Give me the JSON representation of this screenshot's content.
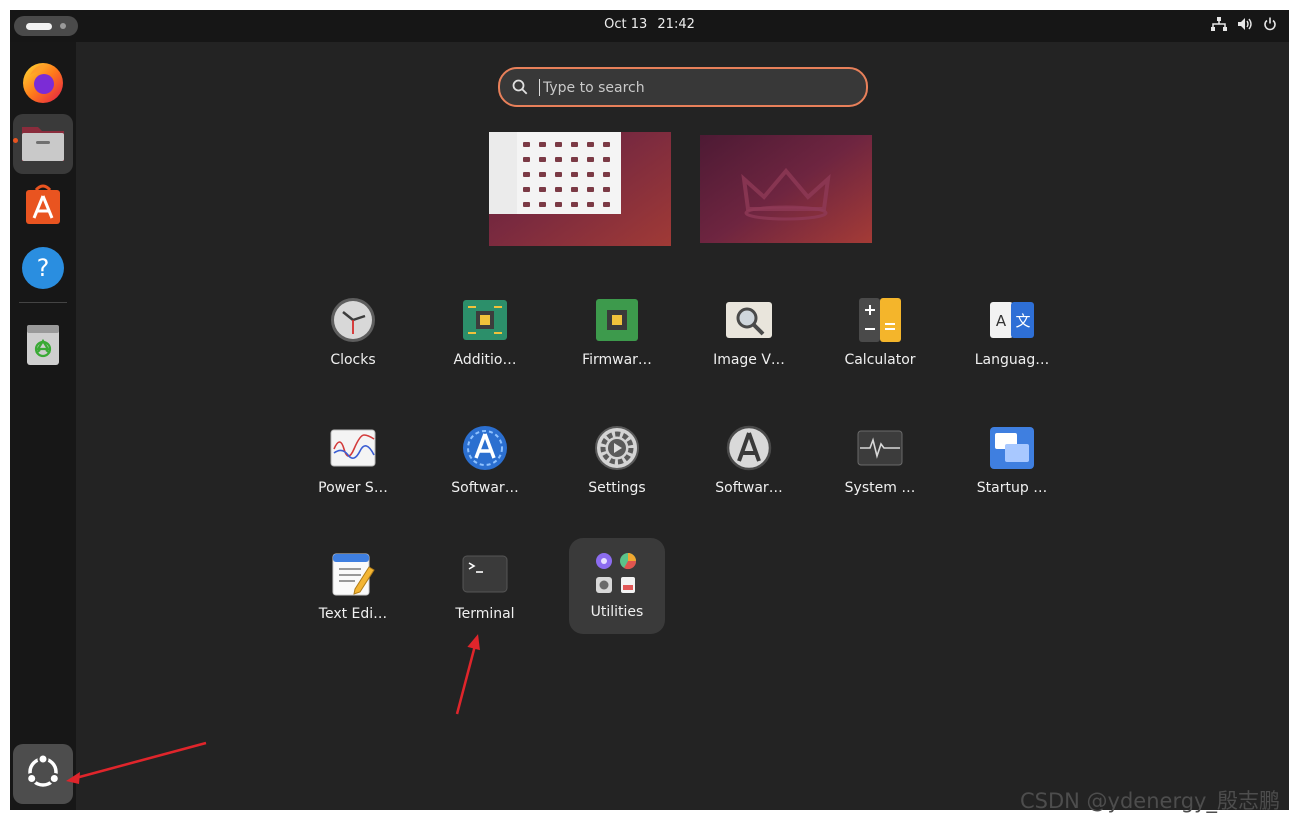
{
  "topbar": {
    "date": "Oct 13",
    "time": "21:42"
  },
  "search": {
    "placeholder": "Type to search"
  },
  "apps": [
    {
      "label": "Clocks",
      "icon": "clock-icon"
    },
    {
      "label": "Additio…",
      "icon": "additional-drivers-icon"
    },
    {
      "label": "Firmwar…",
      "icon": "firmware-icon"
    },
    {
      "label": "Image V…",
      "icon": "image-viewer-icon"
    },
    {
      "label": "Calculator",
      "icon": "calculator-icon"
    },
    {
      "label": "Languag…",
      "icon": "language-support-icon"
    },
    {
      "label": "Power S…",
      "icon": "power-statistics-icon"
    },
    {
      "label": "Softwar…",
      "icon": "software-updater-icon"
    },
    {
      "label": "Settings",
      "icon": "settings-icon"
    },
    {
      "label": "Softwar…",
      "icon": "software-properties-icon"
    },
    {
      "label": "System …",
      "icon": "system-monitor-icon"
    },
    {
      "label": "Startup …",
      "icon": "startup-applications-icon"
    },
    {
      "label": "Text Edi…",
      "icon": "text-editor-icon"
    },
    {
      "label": "Terminal",
      "icon": "terminal-icon"
    }
  ],
  "folder": {
    "label": "Utilities"
  },
  "dock": [
    "firefox-icon",
    "files-icon",
    "app-center-icon",
    "help-icon",
    "trash-icon",
    "show-apps-icon"
  ],
  "colors": {
    "accent": "#e95420",
    "background": "#232323",
    "annotation": "#e0252b"
  },
  "watermark": "CSDN @ydenergy_殷志鹏"
}
